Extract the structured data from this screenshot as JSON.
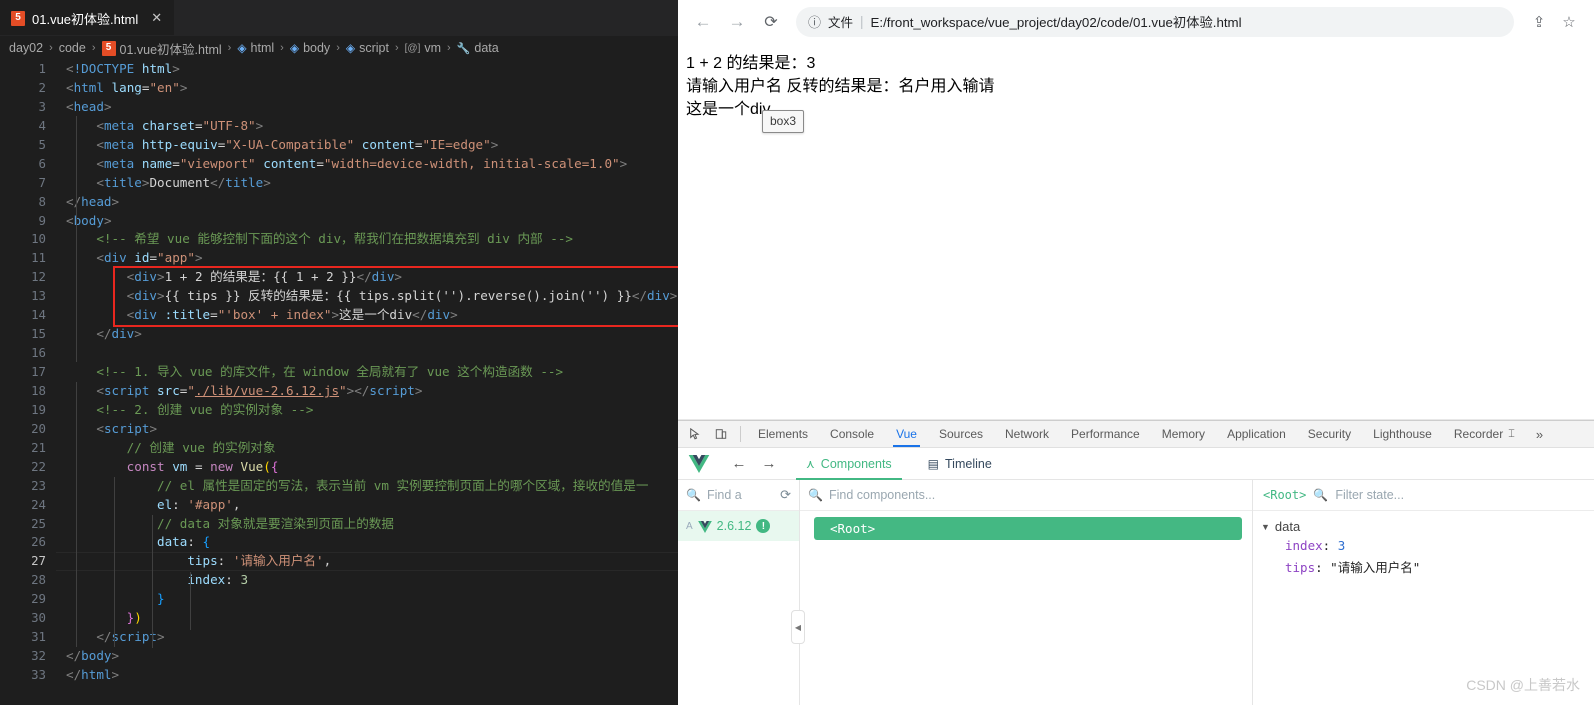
{
  "editor": {
    "tab": {
      "label": "01.vue初体验.html",
      "icon": "html5-icon",
      "close": "✕",
      "badge": "5"
    },
    "breadcrumb": [
      {
        "label": "day02",
        "icon": ""
      },
      {
        "label": "code",
        "icon": ""
      },
      {
        "label": "01.vue初体验.html",
        "icon": "html5-icon"
      },
      {
        "label": "html",
        "icon": "cube-icon"
      },
      {
        "label": "body",
        "icon": "cube-icon"
      },
      {
        "label": "script",
        "icon": "cube-icon"
      },
      {
        "label": "vm",
        "icon": "variable-icon"
      },
      {
        "label": "data",
        "icon": "wrench-icon"
      }
    ],
    "separator": "›",
    "lines": [
      {
        "n": "1",
        "html": "<span class='t-punc'>&lt;</span><span class='t-tag'>!DOCTYPE</span> <span class='t-attr'>html</span><span class='t-punc'>&gt;</span>"
      },
      {
        "n": "2",
        "html": "<span class='t-punc'>&lt;</span><span class='t-tag'>html</span> <span class='t-attr'>lang</span><span class='t-txt'>=</span><span class='t-str'>\"en\"</span><span class='t-punc'>&gt;</span>"
      },
      {
        "n": "3",
        "html": "<span class='t-punc'>&lt;</span><span class='t-tag'>head</span><span class='t-punc'>&gt;</span>"
      },
      {
        "n": "4",
        "html": "    <span class='t-punc'>&lt;</span><span class='t-tag'>meta</span> <span class='t-attr'>charset</span><span class='t-txt'>=</span><span class='t-str'>\"UTF-8\"</span><span class='t-punc'>&gt;</span>"
      },
      {
        "n": "5",
        "html": "    <span class='t-punc'>&lt;</span><span class='t-tag'>meta</span> <span class='t-attr'>http-equiv</span><span class='t-txt'>=</span><span class='t-str'>\"X-UA-Compatible\"</span> <span class='t-attr'>content</span><span class='t-txt'>=</span><span class='t-str'>\"IE=edge\"</span><span class='t-punc'>&gt;</span>"
      },
      {
        "n": "6",
        "html": "    <span class='t-punc'>&lt;</span><span class='t-tag'>meta</span> <span class='t-attr'>name</span><span class='t-txt'>=</span><span class='t-str'>\"viewport\"</span> <span class='t-attr'>content</span><span class='t-txt'>=</span><span class='t-str'>\"width=device-width, initial-scale=1.0\"</span><span class='t-punc'>&gt;</span>"
      },
      {
        "n": "7",
        "html": "    <span class='t-punc'>&lt;</span><span class='t-tag'>title</span><span class='t-punc'>&gt;</span><span class='t-txt'>Document</span><span class='t-punc'>&lt;/</span><span class='t-tag'>title</span><span class='t-punc'>&gt;</span>"
      },
      {
        "n": "8",
        "html": "<span class='t-punc'>&lt;/</span><span class='t-tag'>head</span><span class='t-punc'>&gt;</span>"
      },
      {
        "n": "9",
        "html": "<span class='t-punc'>&lt;</span><span class='t-tag'>body</span><span class='t-punc'>&gt;</span>"
      },
      {
        "n": "10",
        "html": "    <span class='t-com'>&lt;!-- 希望 vue 能够控制下面的这个 div，帮我们在把数据填充到 div 内部 --&gt;</span>"
      },
      {
        "n": "11",
        "html": "    <span class='t-punc'>&lt;</span><span class='t-tag'>div</span> <span class='t-attr'>id</span><span class='t-txt'>=</span><span class='t-str'>\"app\"</span><span class='t-punc'>&gt;</span>"
      },
      {
        "n": "12",
        "html": "        <span class='t-punc'>&lt;</span><span class='t-tag'>div</span><span class='t-punc'>&gt;</span><span class='t-txt'>1 + 2 的结果是：{{ 1 + 2 }}</span><span class='t-punc'>&lt;/</span><span class='t-tag'>div</span><span class='t-punc'>&gt;</span>"
      },
      {
        "n": "13",
        "html": "        <span class='t-punc'>&lt;</span><span class='t-tag'>div</span><span class='t-punc'>&gt;</span><span class='t-txt'>{{ tips }} 反转的结果是：{{ tips.split('').reverse().join('') }}</span><span class='t-punc'>&lt;/</span><span class='t-tag'>div</span><span class='t-punc'>&gt;</span>"
      },
      {
        "n": "14",
        "html": "        <span class='t-punc'>&lt;</span><span class='t-tag'>div</span> <span class='t-attr'>:title</span><span class='t-txt'>=</span><span class='t-str'>\"'box' + index\"</span><span class='t-punc'>&gt;</span><span class='t-txt'>这是一个div</span><span class='t-punc'>&lt;/</span><span class='t-tag'>div</span><span class='t-punc'>&gt;</span>"
      },
      {
        "n": "15",
        "html": "    <span class='t-punc'>&lt;/</span><span class='t-tag'>div</span><span class='t-punc'>&gt;</span>"
      },
      {
        "n": "16",
        "html": ""
      },
      {
        "n": "17",
        "html": "    <span class='t-com'>&lt;!-- 1. 导入 vue 的库文件，在 window 全局就有了 vue 这个构造函数 --&gt;</span>"
      },
      {
        "n": "18",
        "html": "    <span class='t-punc'>&lt;</span><span class='t-tag'>script</span> <span class='t-attr'>src</span><span class='t-txt'>=</span><span class='t-str'>\"</span><span class='t-link'>./lib/vue-2.6.12.js</span><span class='t-str'>\"</span><span class='t-punc'>&gt;&lt;/</span><span class='t-tag'>script</span><span class='t-punc'>&gt;</span>"
      },
      {
        "n": "19",
        "html": "    <span class='t-com'>&lt;!-- 2. 创建 vue 的实例对象 --&gt;</span>"
      },
      {
        "n": "20",
        "html": "    <span class='t-punc'>&lt;</span><span class='t-tag'>script</span><span class='t-punc'>&gt;</span>"
      },
      {
        "n": "21",
        "html": "        <span class='t-com'>// 创建 vue 的实例对象</span>"
      },
      {
        "n": "22",
        "html": "        <span class='t-kw'>const</span> <span class='t-attr'>vm</span> <span class='t-txt'>=</span> <span class='t-kw'>new</span> <span class='t-yellow'>Vue</span><span class='t-brkt1'>(</span><span class='t-brkt2'>{</span>"
      },
      {
        "n": "23",
        "html": "            <span class='t-com'>// el 属性是固定的写法，表示当前 vm 实例要控制页面上的哪个区域，接收的值是一</span>"
      },
      {
        "n": "24",
        "html": "            <span class='t-prop'>el</span><span class='t-txt'>:</span> <span class='t-str'>'#app'</span><span class='t-txt'>,</span>"
      },
      {
        "n": "25",
        "html": "            <span class='t-com'>// data 对象就是要渲染到页面上的数据</span>"
      },
      {
        "n": "26",
        "html": "            <span class='t-prop'>data</span><span class='t-txt'>:</span> <span class='t-brkt3'>{</span>"
      },
      {
        "n": "27",
        "html": "                <span class='t-prop'>tips</span><span class='t-txt'>:</span> <span class='t-str'>'请输入用户名'</span><span class='t-txt'>,</span>",
        "active": true
      },
      {
        "n": "28",
        "html": "                <span class='t-prop'>index</span><span class='t-txt'>:</span> <span class='t-num'>3</span>"
      },
      {
        "n": "29",
        "html": "            <span class='t-brkt3'>}</span>"
      },
      {
        "n": "30",
        "html": "        <span class='t-brkt2'>}</span><span class='t-brkt1'>)</span>"
      },
      {
        "n": "31",
        "html": "    <span class='t-punc'>&lt;/</span><span class='t-tag'>script</span><span class='t-punc'>&gt;</span>"
      },
      {
        "n": "32",
        "html": "<span class='t-punc'>&lt;/</span><span class='t-tag'>body</span><span class='t-punc'>&gt;</span>"
      },
      {
        "n": "33",
        "html": "<span class='t-punc'>&lt;/</span><span class='t-tag'>html</span><span class='t-punc'>&gt;</span>"
      }
    ],
    "highlight_color": "#e8271f"
  },
  "browser": {
    "nav": {
      "back": "←",
      "forward": "→",
      "reload": "⟳"
    },
    "omnibox": {
      "info_icon": "info-icon",
      "scheme_label": "文件",
      "url": "E:/front_workspace/vue_project/day02/code/01.vue初体验.html"
    },
    "share_icon": "share-icon",
    "bookmark_icon": "star-icon",
    "page": {
      "line1": "1 + 2 的结果是：3",
      "line2": "请输入用户名 反转的结果是：名户用入输请",
      "line3": "这是一个div",
      "tooltip": "box3"
    }
  },
  "devtools": {
    "tools": {
      "inspect": "inspect-icon",
      "device": "device-toggle-icon"
    },
    "tabs": [
      {
        "label": "Elements",
        "active": false
      },
      {
        "label": "Console",
        "active": false
      },
      {
        "label": "Vue",
        "active": true
      },
      {
        "label": "Sources",
        "active": false
      },
      {
        "label": "Network",
        "active": false
      },
      {
        "label": "Performance",
        "active": false
      },
      {
        "label": "Memory",
        "active": false
      },
      {
        "label": "Application",
        "active": false
      },
      {
        "label": "Security",
        "active": false
      },
      {
        "label": "Lighthouse",
        "active": false
      },
      {
        "label": "Recorder",
        "active": false
      }
    ],
    "more": "»",
    "vuebar": {
      "logo": "vue-logo-icon",
      "back": "←",
      "forward": "→",
      "tabs": [
        {
          "label": "Components",
          "active": true,
          "icon": "components-icon"
        },
        {
          "label": "Timeline",
          "active": false,
          "icon": "timeline-icon"
        }
      ]
    },
    "left_panel": {
      "find_placeholder": "Find a",
      "refresh_icon": "refresh-icon",
      "version": "2.6.12",
      "badge": "!",
      "prefix": "A"
    },
    "mid_panel": {
      "find_placeholder": "Find components...",
      "selected_component": "<Root>"
    },
    "right_panel": {
      "root_label": "<Root>",
      "filter_placeholder": "Filter state...",
      "group": "data",
      "entries": [
        {
          "key": "index",
          "value": "3",
          "type": "number"
        },
        {
          "key": "tips",
          "value": "\"请输入用户名\"",
          "type": "string"
        }
      ]
    },
    "collapse_icon": "collapse-left-icon"
  },
  "watermark": "CSDN @上善若水"
}
